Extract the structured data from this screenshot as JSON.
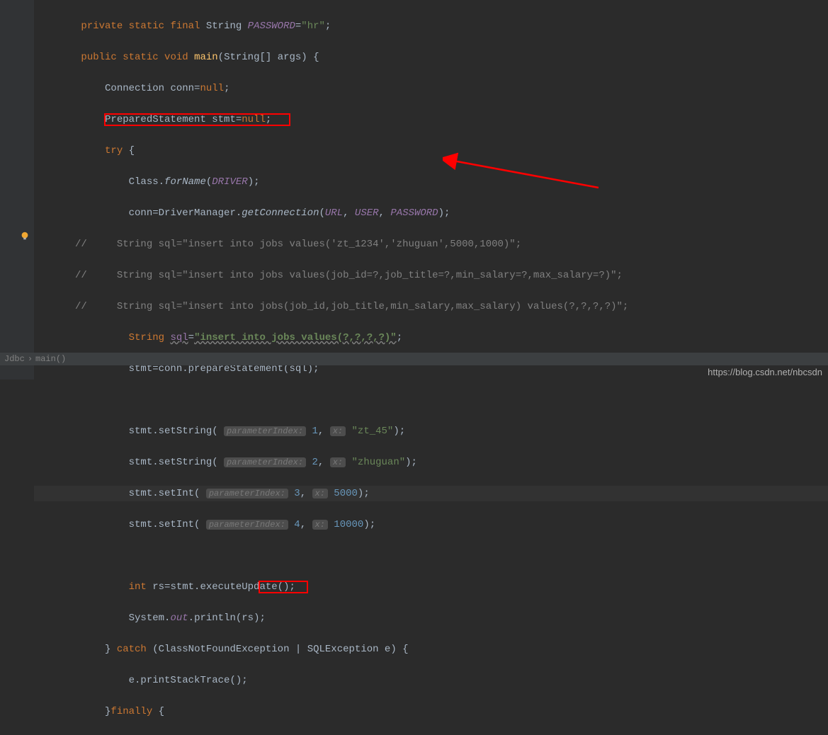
{
  "code": {
    "l1_kw1": "private static final ",
    "l1_cls": "String ",
    "l1_field": "PASSWORD",
    "l1_eq": "=",
    "l1_str": "\"hr\"",
    "l1_semi": ";",
    "l2_kw": "public static void ",
    "l2_mname": "main",
    "l2_p": "(",
    "l2_cls": "String",
    "l2_arr": "[] args) {",
    "l3_cls": "Connection ",
    "l3_var": "conn=",
    "l3_kw": "null",
    "l3_semi": ";",
    "l4_cls": "PreparedStatement ",
    "l4_var": "stmt=",
    "l4_kw": "null",
    "l4_semi": ";",
    "l5_kw": "try ",
    "l5_brace": "{",
    "l6_cls": "Class",
    "l6_dot": ".",
    "l6_fn": "forName",
    "l6_p": "(",
    "l6_field": "DRIVER",
    "l6_pc": ");",
    "l7_var": "conn=",
    "l7_cls": "DriverManager",
    "l7_dot": ".",
    "l7_fn": "getConnection",
    "l7_p": "(",
    "l7_f1": "URL",
    "l7_c1": ", ",
    "l7_f2": "USER",
    "l7_c2": ", ",
    "l7_f3": "PASSWORD",
    "l7_pc": ");",
    "l8_slash": "//",
    "l8_txt": "            String sql=\"insert into jobs values('zt_1234','zhuguan',5000,1000)\";",
    "l9_slash": "//",
    "l9_txt": "            String sql=\"insert into jobs values(job_id=?,job_title=?,min_salary=?,max_salary=?)\";",
    "l10_slash": "//",
    "l10_txt": "            String sql=\"insert into jobs(job_id,job_title,min_salary,max_salary) values(?,?,?,?)\";",
    "l11_cls": "String ",
    "l11_var": "sql",
    "l11_eq": "=",
    "l11_str": "\"insert into jobs values(?,?,?,?)\"",
    "l11_semi": ";",
    "l12": "stmt=conn.prepareStatement(sql);",
    "l14a": "stmt.setString( ",
    "l14hint": "parameterIndex:",
    "l14n": " 1",
    "l14c": ", ",
    "l14hint2": "x:",
    "l14s": " \"zt_45\"",
    "l14e": ");",
    "l15a": "stmt.setString( ",
    "l15hint": "parameterIndex:",
    "l15n": " 2",
    "l15c": ", ",
    "l15hint2": "x:",
    "l15s": " \"zhuguan\"",
    "l15e": ");",
    "l16a": "stmt.setInt( ",
    "l16hint": "parameterIndex:",
    "l16n": " 3",
    "l16c": ", ",
    "l16hint2": "x:",
    "l16s": " 5000",
    "l16e": ");",
    "l17a": "stmt.setInt( ",
    "l17hint": "parameterIndex:",
    "l17n": " 4",
    "l17c": ", ",
    "l17hint2": "x:",
    "l17s": " 10000",
    "l17e": ");",
    "l19_kw": "int ",
    "l19_txt": "rs=stmt.executeUpdate();",
    "l20_cls": "System",
    "l20_dot": ".",
    "l20_out": "out",
    "l20_rest": ".println(rs);",
    "l21_b": "} ",
    "l21_kw": "catch ",
    "l21_p": "(",
    "l21_e1": "ClassNotFoundException ",
    "l21_bar": "| ",
    "l21_e2": "SQLException ",
    "l21_v": "e) {",
    "l22": "e.printStackTrace();",
    "l23_b": "}",
    "l23_kw": "finally ",
    "l23_brace": "{"
  },
  "status": {
    "part1": "Jdbc",
    "sep": "›",
    "part2": "main()"
  },
  "watermark": "https://blog.csdn.net/nbcsdn"
}
